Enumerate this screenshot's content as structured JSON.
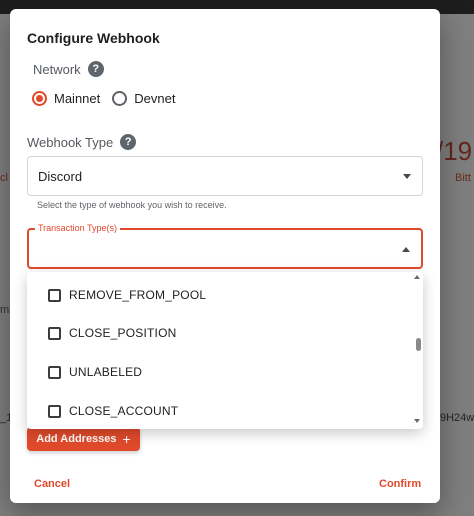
{
  "background": {
    "big_fragment": "/19",
    "left_fragment": "cl",
    "right_fragment": "Bitt",
    "mid_fragment": "mi",
    "row_fragment_left": "_1",
    "row_fragment_right": "9H24w"
  },
  "dialog": {
    "title": "Configure Webhook",
    "network": {
      "label": "Network",
      "options": [
        {
          "label": "Mainnet",
          "selected": true
        },
        {
          "label": "Devnet",
          "selected": false
        }
      ]
    },
    "webhook_type": {
      "label": "Webhook Type",
      "value": "Discord",
      "helper": "Select the type of webhook you wish to receive."
    },
    "transaction_types": {
      "label": "Transaction Type(s)",
      "value": "",
      "menu_items": [
        {
          "label": "REMOVE_FROM_POOL",
          "checked": false
        },
        {
          "label": "CLOSE_POSITION",
          "checked": false
        },
        {
          "label": "UNLABELED",
          "checked": false
        },
        {
          "label": "CLOSE_ACCOUNT",
          "checked": false
        }
      ]
    },
    "add_addresses_label": "Add Addresses",
    "cancel_label": "Cancel",
    "confirm_label": "Confirm"
  },
  "colors": {
    "accent": "#e04a2b",
    "text": "#1f1f1f",
    "muted": "#555a60"
  },
  "icons": {
    "help": "question-mark-circle",
    "add": "plus",
    "dropdown": "caret-down",
    "dropdown_open": "caret-up"
  }
}
